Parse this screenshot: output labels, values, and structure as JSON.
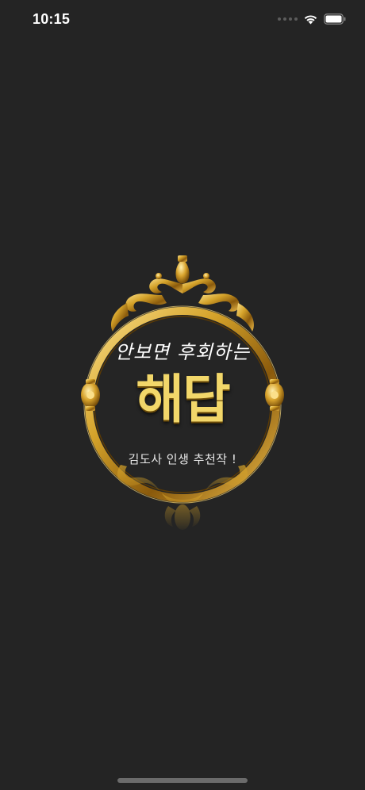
{
  "status_bar": {
    "time": "10:15",
    "icons": [
      "cellular-signal-icon",
      "wifi-icon",
      "battery-icon"
    ]
  },
  "splash": {
    "tagline": "안보면 후회하는",
    "app_name": "해답",
    "subtitle": "김도사 인생 추천작 !",
    "logo_frame": "ornate-gold-circular-mirror-frame"
  },
  "colors": {
    "background": "#242424",
    "gold": "#d4a22a",
    "gold_light": "#f2d76a",
    "gold_dark": "#7a4f08"
  }
}
